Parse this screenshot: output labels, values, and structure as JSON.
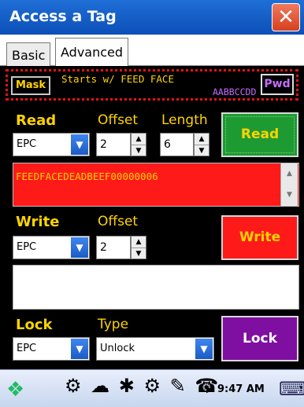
{
  "window": {
    "title": "Access a Tag",
    "close_glyph": "✕"
  },
  "tabs": [
    {
      "label": "Basic"
    },
    {
      "label": "Advanced"
    }
  ],
  "mask": {
    "button_label": "Mask",
    "text": "Starts w/ FEED FACE",
    "value": "AABBCCDD",
    "pwd_label": "Pwd"
  },
  "read": {
    "label": "Read",
    "offset_label": "Offset",
    "length_label": "Length",
    "bank": "EPC",
    "offset": "2",
    "length": "6",
    "button_label": "Read",
    "result": "FEEDFACEDEADBEEF00000006"
  },
  "write": {
    "label": "Write",
    "offset_label": "Offset",
    "bank": "EPC",
    "offset": "2",
    "button_label": "Write",
    "data": ""
  },
  "lock": {
    "label": "Lock",
    "type_label": "Type",
    "bank": "EPC",
    "type": "Unlock",
    "button_label": "Lock"
  },
  "taskbar": {
    "time": "9:47 AM"
  },
  "icons": {
    "close": "close-icon",
    "dropdown": "chevron-down-icon",
    "up": "arrow-up-icon",
    "down": "arrow-down-icon"
  },
  "colors": {
    "panel": "#000000",
    "accent_yellow": "#ffd400",
    "read_green": "#1e9a32",
    "write_red": "#ff1a1a",
    "lock_purple": "#7f0fa0"
  }
}
